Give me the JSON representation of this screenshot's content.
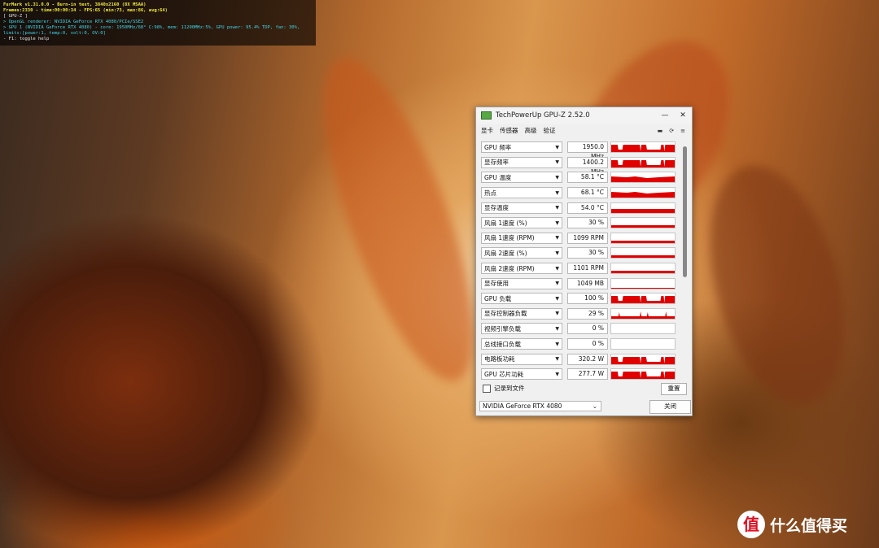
{
  "furmark": {
    "line1": "FurMark v1.31.0.0 - Burn-in test, 3840x2160 (8X MSAA)",
    "line2": "Frames:2330 - time:00:00:34 - FPS:65 (min:73, max:86, avg:64)",
    "line3": "[ GPU-Z ]",
    "line4": "> OpenGL renderer: NVIDIA GeForce RTX 4080/PCIe/SSE2",
    "line5": "> GPU 1 (NVIDIA GeForce RTX 4080) - core: 1950MHz/68° C:98%, mem: 11200MHz:5%, GPU power: 95.4% TDP, fan: 30%, limits:[power:1, temp:0, volt:0, OV:0]",
    "line6": "- F1: toggle help"
  },
  "gpuz": {
    "title": "TechPowerUp GPU-Z 2.52.0",
    "window_buttons": {
      "minimize": "—",
      "close": "✕"
    },
    "menu": [
      "显卡",
      "传感器",
      "高级",
      "验证"
    ],
    "sensors": [
      {
        "label": "GPU 频率",
        "value": "1950.0 MHz",
        "graph": "spiky-high"
      },
      {
        "label": "显存频率",
        "value": "1400.2 MHz",
        "graph": "spiky-high"
      },
      {
        "label": "GPU 温度",
        "value": "58.1 °C",
        "graph": "mid"
      },
      {
        "label": "热点",
        "value": "68.1 °C",
        "graph": "mid"
      },
      {
        "label": "显存温度",
        "value": "54.0 °C",
        "graph": "flat-mid"
      },
      {
        "label": "风扇 1速度 (%)",
        "value": "30 %",
        "graph": "line"
      },
      {
        "label": "风扇 1速度 (RPM)",
        "value": "1099 RPM",
        "graph": "line"
      },
      {
        "label": "风扇 2速度 (%)",
        "value": "30 %",
        "graph": "line"
      },
      {
        "label": "风扇 2速度 (RPM)",
        "value": "1101 RPM",
        "graph": "line"
      },
      {
        "label": "显存使用",
        "value": "1049 MB",
        "graph": "thin"
      },
      {
        "label": "GPU 负载",
        "value": "100 %",
        "graph": "spiky-high"
      },
      {
        "label": "显存控制器负载",
        "value": "29 %",
        "graph": "low-spiky"
      },
      {
        "label": "视频引擎负载",
        "value": "0 %",
        "graph": "empty"
      },
      {
        "label": "总线接口负载",
        "value": "0 %",
        "graph": "empty"
      },
      {
        "label": "电路板功耗",
        "value": "320.2 W",
        "graph": "spiky-high"
      },
      {
        "label": "GPU 芯片功耗",
        "value": "277.7 W",
        "graph": "spiky-high"
      }
    ],
    "log_label": "记录到文件",
    "reset_label": "重置",
    "gpu_select": "NVIDIA GeForce RTX 4080",
    "close_label": "关闭"
  },
  "watermark": {
    "logo": "值",
    "text": "什么值得买"
  }
}
